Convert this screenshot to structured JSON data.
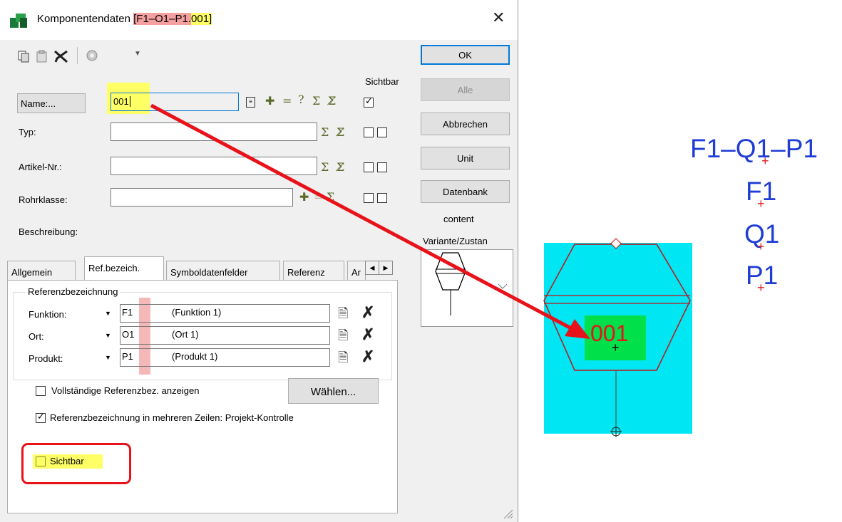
{
  "dialog": {
    "title_prefix": "Komponentendaten ",
    "title_bracket_open": "[",
    "title_ref": "F1–O1–P1.",
    "title_name": "001",
    "title_bracket_close": "]",
    "close_label": "✕"
  },
  "toolbar": {
    "copy_icon": "copy-icon",
    "paste_icon": "paste-icon",
    "delete_icon": "delete-icon",
    "settings_icon": "gear-icon"
  },
  "buttons": {
    "ok": "OK",
    "alle": "Alle",
    "abbrechen": "Abbrechen",
    "unit": "Unit",
    "datenbank": "Datenbank",
    "waehlen": "Wählen..."
  },
  "fields": {
    "sichtbar_header": "Sichtbar",
    "name_button": "Name:...",
    "name_value": "001",
    "typ_label": "Typ:",
    "artikel_label": "Artikel-Nr.:",
    "rohrklasse_label": "Rohrklasse:",
    "beschreibung_label": "Beschreibung:"
  },
  "side": {
    "content_label": "content",
    "variante_label": "Variante/Zustan"
  },
  "tabs": [
    "Allgemein",
    "Ref.bezeich.",
    "Symboldatenfelder",
    "Referenz",
    "Ar"
  ],
  "refbez": {
    "group_title": "Referenzbezeichnung",
    "rows": [
      {
        "label": "Funktion:",
        "code": "F1",
        "desc": "(Funktion 1)"
      },
      {
        "label": "Ort:",
        "code": "O1",
        "desc": "(Ort 1)"
      },
      {
        "label": "Produkt:",
        "code": "P1",
        "desc": "(Produkt 1)"
      }
    ],
    "vollstaendig": "Vollständige Referenzbez. anzeigen",
    "mehrzeilig": "Referenzbezeichnung in mehreren Zeilen: Projekt-Kontrolle",
    "sichtbar": "Sichtbar"
  },
  "canvas": {
    "label_001": "001",
    "ref_full": "F1–Q1–P1",
    "ref_f": "F1",
    "ref_q": "Q1",
    "ref_p": "P1"
  },
  "colors": {
    "accent_blue": "#0078d7",
    "highlight_yellow": "#ffff66",
    "highlight_red": "#f4a0a0",
    "annotation_red": "#e8121a",
    "canvas_cyan": "#00e6f2",
    "label_green": "#00e04a",
    "ref_blue": "#1e3cd6"
  }
}
